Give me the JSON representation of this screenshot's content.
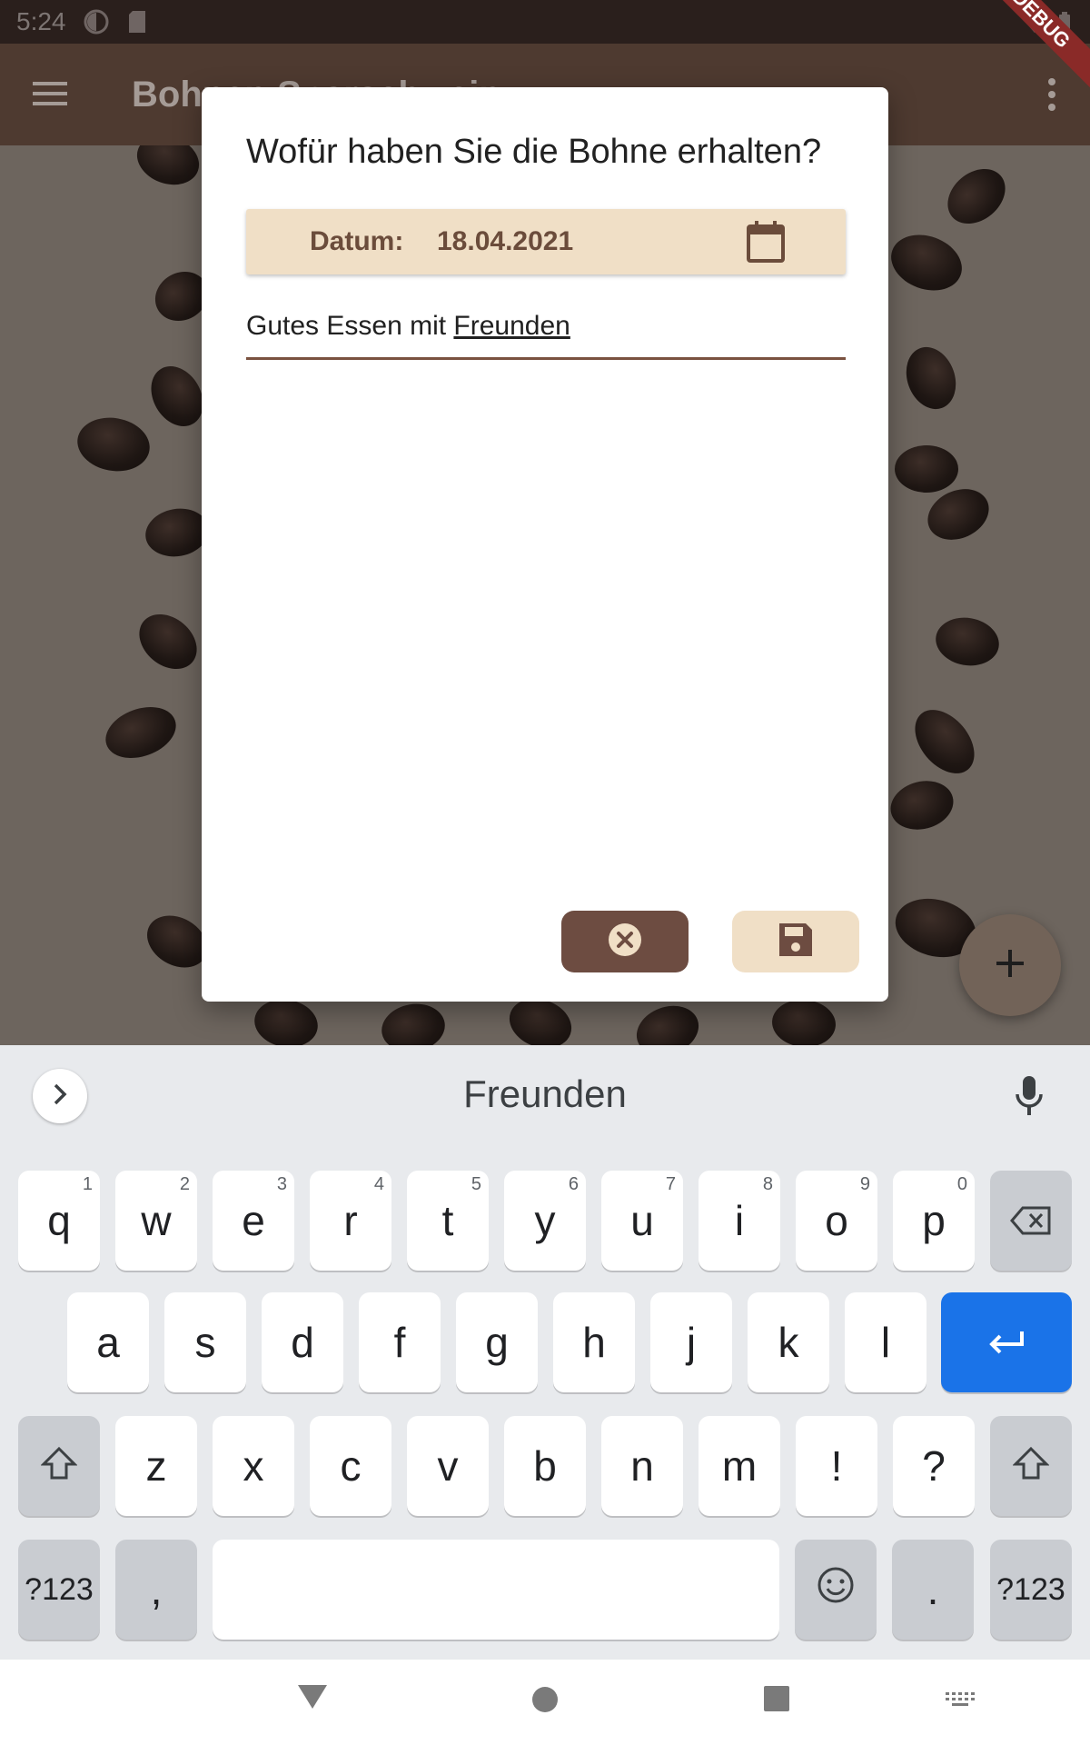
{
  "status_bar": {
    "time": "5:24"
  },
  "app_bar": {
    "title": "Bohnen Sparschwein",
    "debug_label": "DEBUG"
  },
  "dialog": {
    "title": "Wofür haben Sie die Bohne erhalten?",
    "date_label": "Datum:",
    "date_value": "18.04.2021",
    "text_value_prefix": "Gutes Essen mit ",
    "text_value_underlined": "Freunden"
  },
  "colors": {
    "brown_dark": "#6d4c41",
    "beige": "#f0dfc6",
    "app_bar": "#4e3a30",
    "keyboard_enter": "#1a73e8"
  },
  "keyboard": {
    "suggestion": "Freunden",
    "row1": [
      {
        "label": "q",
        "hint": "1"
      },
      {
        "label": "w",
        "hint": "2"
      },
      {
        "label": "e",
        "hint": "3"
      },
      {
        "label": "r",
        "hint": "4"
      },
      {
        "label": "t",
        "hint": "5"
      },
      {
        "label": "y",
        "hint": "6"
      },
      {
        "label": "u",
        "hint": "7"
      },
      {
        "label": "i",
        "hint": "8"
      },
      {
        "label": "o",
        "hint": "9"
      },
      {
        "label": "p",
        "hint": "0"
      }
    ],
    "row2": [
      "a",
      "s",
      "d",
      "f",
      "g",
      "h",
      "j",
      "k",
      "l"
    ],
    "row3": [
      "z",
      "x",
      "c",
      "v",
      "b",
      "n",
      "m",
      "!",
      "?"
    ],
    "symbols_label": "?123",
    "comma_label": ",",
    "period_label": "."
  }
}
